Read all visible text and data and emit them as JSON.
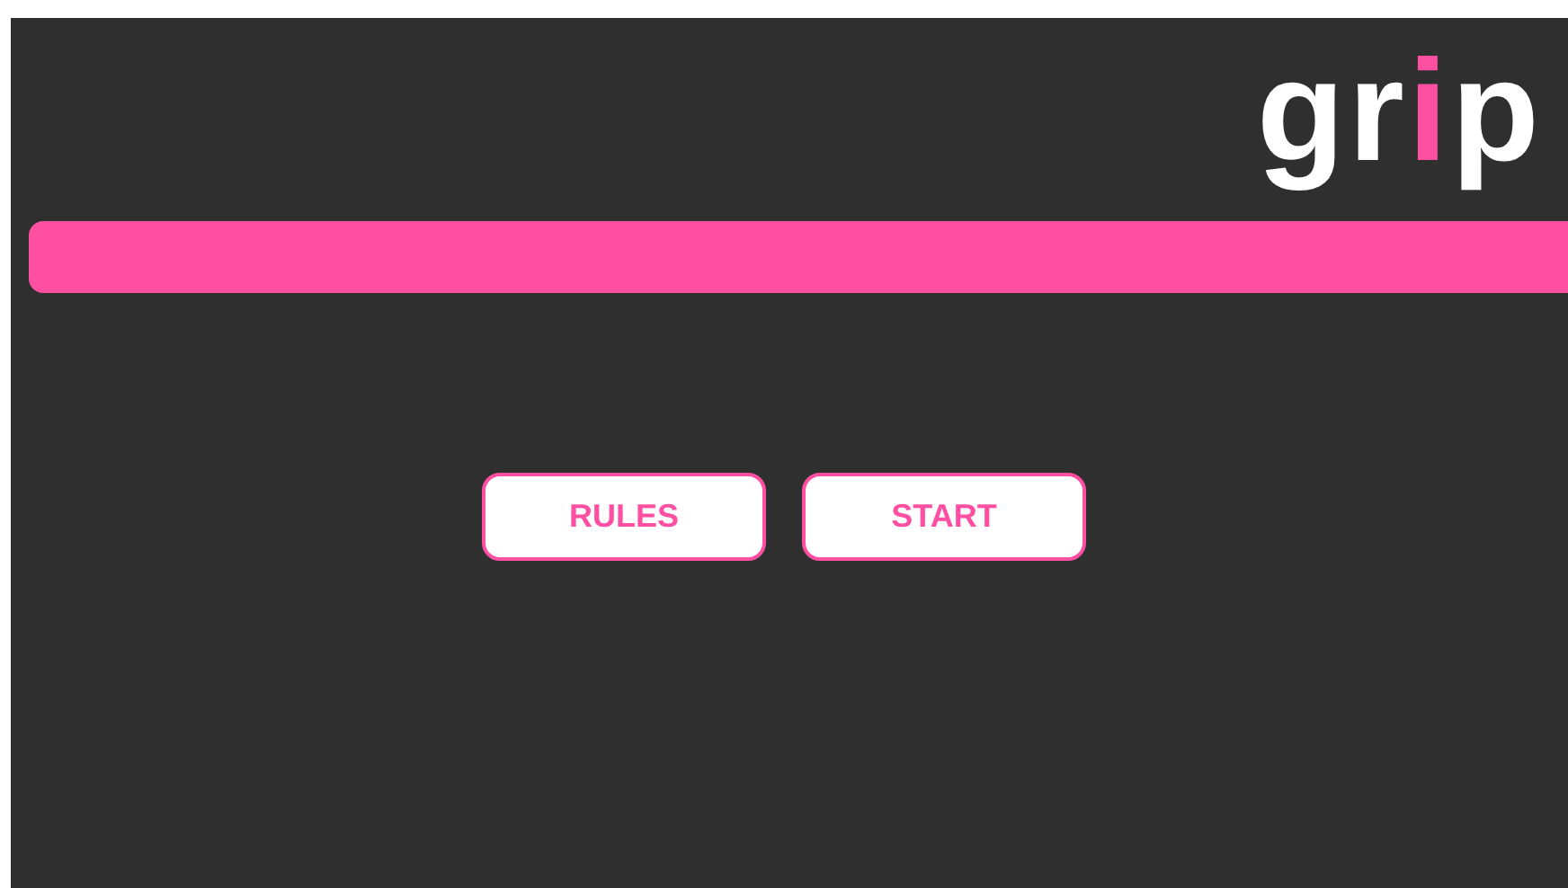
{
  "logo": {
    "text": "grip"
  },
  "buttons": [
    {
      "label": "RULES"
    },
    {
      "label": "START"
    }
  ]
}
